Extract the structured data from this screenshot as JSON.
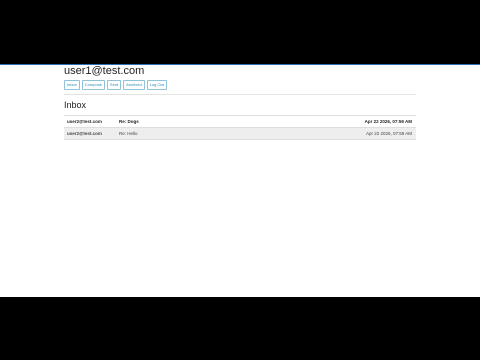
{
  "user": {
    "email": "user1@test.com"
  },
  "nav": {
    "buttons": [
      "Inbox",
      "Compose",
      "Sent",
      "Archived",
      "Log Out"
    ]
  },
  "inbox": {
    "title": "Inbox",
    "emails": [
      {
        "from": "user2@test.com",
        "subject": "Re: Dogs",
        "date": "Apr 22 2026, 07:59 AM",
        "read": false
      },
      {
        "from": "user2@test.com",
        "subject": "Re: Hello",
        "date": "Apr 22 2026, 07:59 AM",
        "read": true
      }
    ]
  },
  "colors": {
    "accent": "#2a8ab8",
    "read_row_bg": "#eeeeee",
    "frame_bg": "#000000"
  }
}
